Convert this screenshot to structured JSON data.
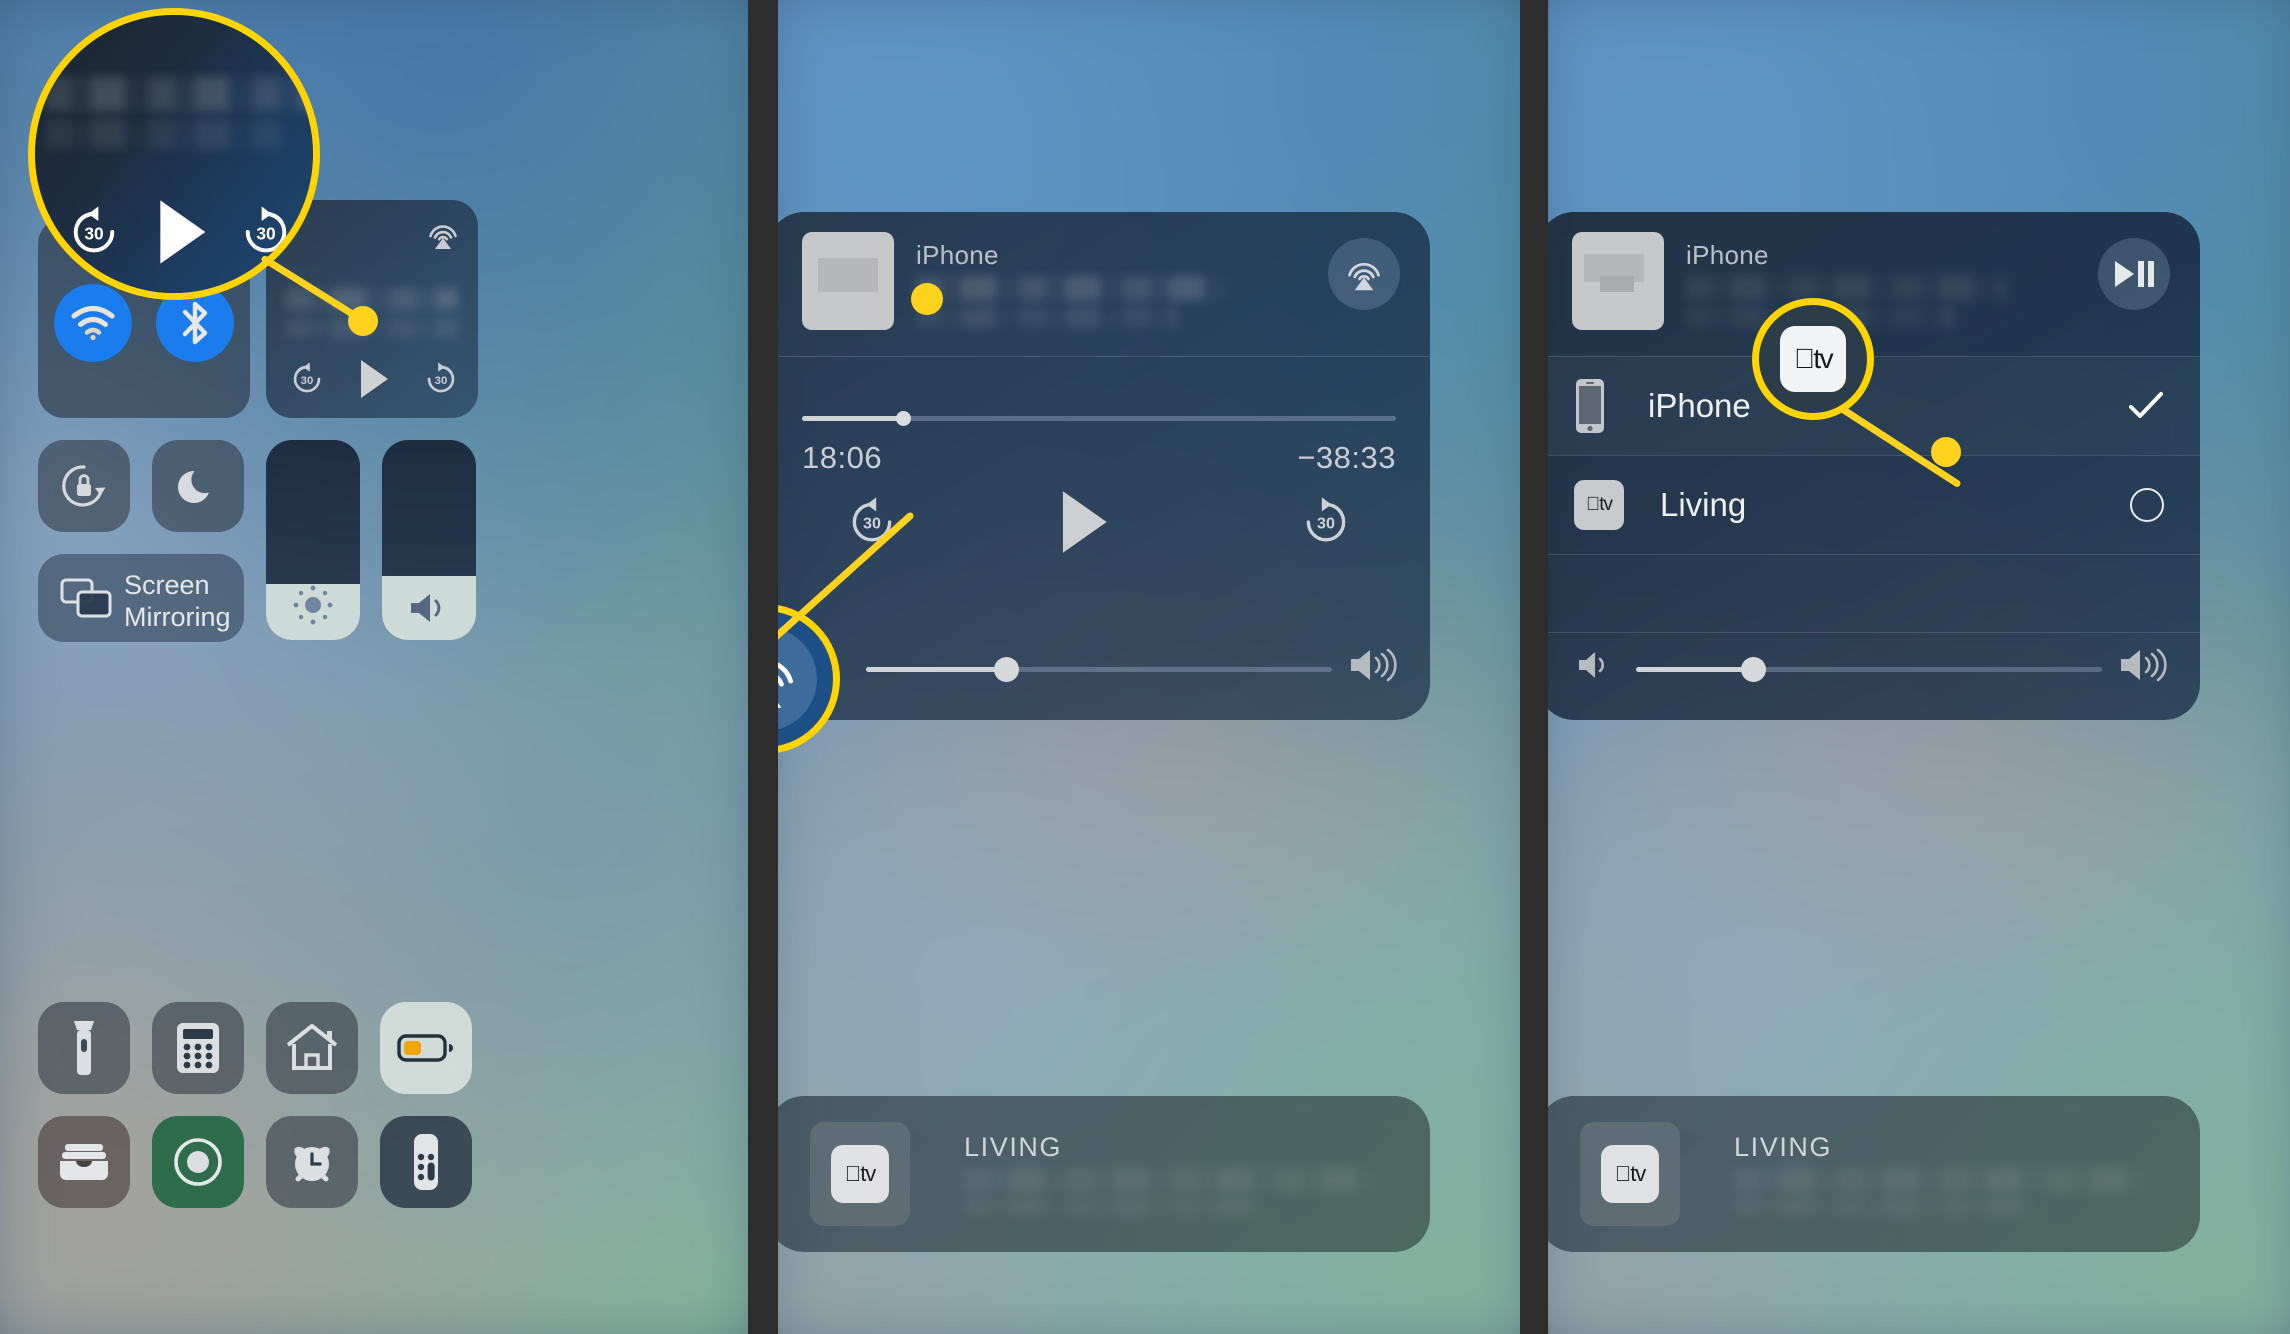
{
  "meta": {
    "panel_count": 3
  },
  "panel1": {
    "name": "control-center-overview",
    "media_card": {
      "airplay_icon": "airplay-audio-icon",
      "rewind_label": "30",
      "forward_label": "30",
      "play_icon": "play-icon"
    },
    "connectivity": {
      "wifi_icon": "wifi-icon",
      "bluetooth_icon": "bluetooth-icon"
    },
    "toggles": [
      {
        "name": "rotation-lock",
        "icon": "rotation-lock-icon"
      },
      {
        "name": "do-not-disturb",
        "icon": "moon-icon"
      }
    ],
    "screen_mirroring": {
      "label_line1": "Screen",
      "label_line2": "Mirroring",
      "icon": "screen-mirroring-icon"
    },
    "sliders": {
      "brightness_icon": "brightness-icon",
      "brightness_value": 28,
      "volume_icon": "volume-icon",
      "volume_value": 32
    },
    "shortcuts": [
      {
        "name": "flashlight",
        "icon": "flashlight-icon"
      },
      {
        "name": "calculator",
        "icon": "calculator-icon"
      },
      {
        "name": "home",
        "icon": "home-icon"
      },
      {
        "name": "low-power",
        "icon": "battery-icon"
      },
      {
        "name": "wallet",
        "icon": "wallet-icon"
      },
      {
        "name": "screen-record",
        "icon": "record-icon"
      },
      {
        "name": "alarm",
        "icon": "alarm-clock-icon"
      },
      {
        "name": "apple-tv-remote",
        "icon": "remote-icon"
      }
    ],
    "magnifier": {
      "rewind_label": "30",
      "forward_label": "30",
      "play_icon": "play-icon"
    }
  },
  "panel2": {
    "name": "now-playing-expanded",
    "source_label": "iPhone",
    "airplay_icon": "airplay-audio-icon",
    "progress": {
      "elapsed": "18:06",
      "remaining": "−38:33",
      "percent": 17
    },
    "transport": {
      "rewind_label": "30",
      "play_icon": "play-icon",
      "forward_label": "30"
    },
    "volume": {
      "low_icon": "volume-low-icon",
      "high_icon": "volume-high-icon",
      "percent": 30
    },
    "living_card": {
      "title": "LIVING",
      "icon": "apple-tv-icon"
    },
    "magnifier": {
      "icon": "airplay-audio-icon"
    }
  },
  "panel3": {
    "name": "airplay-device-picker",
    "source_label": "iPhone",
    "playpause_icon": "play-pause-icon",
    "devices": [
      {
        "name": "iPhone",
        "icon": "iphone-icon",
        "selected": true,
        "state_icon": "checkmark-icon"
      },
      {
        "name": "Living",
        "icon": "apple-tv-icon",
        "selected": false,
        "state_icon": "empty-circle-icon"
      }
    ],
    "volume": {
      "low_icon": "volume-low-icon",
      "high_icon": "volume-high-icon",
      "percent": 25
    },
    "living_card": {
      "title": "LIVING",
      "icon": "apple-tv-icon"
    },
    "magnifier": {
      "icon": "apple-tv-icon"
    }
  },
  "colors": {
    "callout": "#FFD400",
    "callout_dot": "#FFD21E",
    "accent_blue": "#1a7ced",
    "battery_yellow": "#F0A500",
    "record_green": "#0e5c34"
  }
}
